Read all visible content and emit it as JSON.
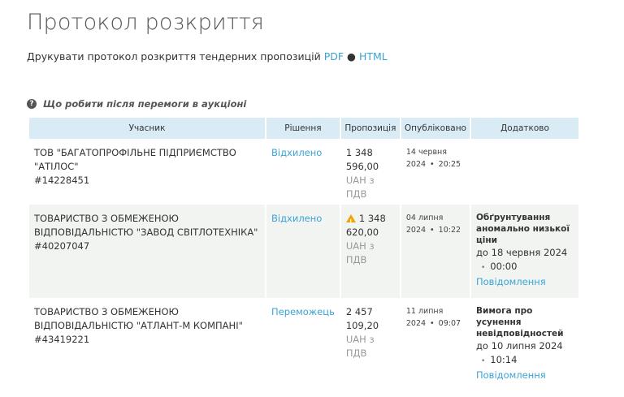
{
  "page": {
    "title": "Протокол розкриття",
    "print_text": "Друкувати протокол розкриття тендерних пропозицій",
    "pdf_link": "PDF",
    "separator": "●",
    "html_link": "HTML",
    "help_icon": "?",
    "help_text": "Що робити після перемоги в аукціоні"
  },
  "table": {
    "headers": [
      "Учасник",
      "Рішення",
      "Пропозиція",
      "Опубліковано",
      "Додатково"
    ],
    "rows": [
      {
        "participant_line1": "ТОВ \"БАГАТОПРОФІЛЬНЕ ПІДПРИЄМСТВО",
        "participant_line2": "\"АТІЛОС\"",
        "participant_id": "#14228451",
        "decision": "Відхилено",
        "amount_line1": "1 348",
        "amount_line2": "596,00",
        "currency": "UAH з",
        "vat": "ПДВ",
        "date": "14 червня",
        "year": "2024",
        "time": "20:25",
        "extra": null
      },
      {
        "participant_line1": "ТОВАРИСТВО З ОБМЕЖЕНОЮ",
        "participant_line2": "ВІДПОВІДАЛЬНІСТЮ \"ЗАВОД СВІТЛОТЕХНІКА\"",
        "participant_id": "#40207047",
        "decision": "Відхилено",
        "warning_icon": "warning-icon",
        "amount_line1": "1 348",
        "amount_line2": "620,00",
        "currency": "UAH з",
        "vat": "ПДВ",
        "date": "04 липня",
        "year": "2024",
        "time": "10:22",
        "extra": {
          "title_line1": "Обґрунтування",
          "title_line2": "аномально низької",
          "title_line3": "ціни",
          "deadline": "до 18 червня 2024",
          "time": "00:00",
          "link": "Повідомлення"
        }
      },
      {
        "participant_line1": "ТОВАРИСТВО З ОБМЕЖЕНОЮ",
        "participant_line2": "ВІДПОВІДАЛЬНІСТЮ \"АТЛАНТ-М КОМПАНІ\"",
        "participant_id": "#43419221",
        "decision": "Переможець",
        "amount_line1": "2 457",
        "amount_line2": "109,20",
        "currency": "UAH з",
        "vat": "ПДВ",
        "date": "11 липня",
        "year": "2024",
        "time": "09:07",
        "extra": {
          "title_line1": "Вимога про",
          "title_line2": "усунення",
          "title_line3": "невідповідностей",
          "deadline": "до 10 липня 2024",
          "time": "10:14",
          "link": "Повідомлення"
        }
      }
    ]
  },
  "colors": {
    "link": "#3aa3d6",
    "header_bg": "#d9ecf5",
    "alt_row_bg": "#f2f4f2",
    "warning": "#f0a500"
  }
}
